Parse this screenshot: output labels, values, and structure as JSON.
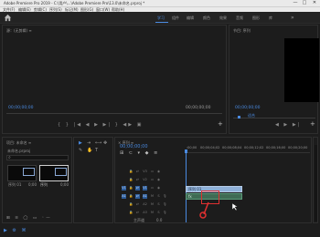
{
  "title_bar": {
    "text": "Adobe Premiere Pro 2019 - C:\\用户\\...\\Adobe Premiere Pro\\13.0\\未命名.prproj *",
    "minimize": "—",
    "maximize": "□",
    "close": "✕"
  },
  "menu": [
    "文件(F)",
    "编辑(E)",
    "剪辑(C)",
    "序列(S)",
    "标记(M)",
    "图形(G)",
    "窗口(W)",
    "帮助(H)"
  ],
  "workspaces": {
    "items": [
      "学习",
      "组件",
      "编辑",
      "颜色",
      "效果",
      "音频",
      "图形",
      "库"
    ],
    "active_index": 0,
    "more": "»"
  },
  "source_panel": {
    "title": "源：(无剪辑)  ≡",
    "timecode_left": "00;00;00;00",
    "timecode_right": "00;00;00;00",
    "controls": "{ } |◀ ◀ ▶ ▶| } ◀▶ ▣",
    "add": "+"
  },
  "program_panel": {
    "title": "节目: 序列",
    "timecode": "00;00;00;00",
    "fit": "适合",
    "controls": "◀ ▶ ▶|",
    "add": "+"
  },
  "project_panel": {
    "title": "项目: 未命名  ≡",
    "file": "未命名.prproj",
    "search_icon": "⌕",
    "thumbs": [
      {
        "label": "序列 01",
        "info": "0;00"
      },
      {
        "label": "序列",
        "info": "0;00"
      }
    ],
    "bottom_icons": "⊞ ≡ ◯ ▭ ◦—"
  },
  "tools": [
    "▶",
    "⇥",
    "⟷",
    "✥",
    "✎",
    "✋",
    "T"
  ],
  "sequence_panel": {
    "title": "× 序列  ≡",
    "timecode": "00;00;00;00",
    "ruler": [
      ":00;00",
      "00;00;04;02",
      "00;00;08;04",
      "00;00;12;02",
      "00;00;16;00",
      "00;00;20;00"
    ],
    "video_tracks": [
      "V3",
      "V2",
      "V1"
    ],
    "audio_tracks": [
      "A1",
      "A2",
      "A3"
    ],
    "master": "主声道",
    "master_value": "0.0",
    "clip_v": "序列 01",
    "clip_a": "fx"
  },
  "status": {
    "icons": "▶ ⚙ ⌘"
  },
  "colors": {
    "accent": "#4a8ae0",
    "clip_video": "#8fb0d8",
    "clip_audio": "#5b9a7a",
    "highlight": "#e03030"
  }
}
